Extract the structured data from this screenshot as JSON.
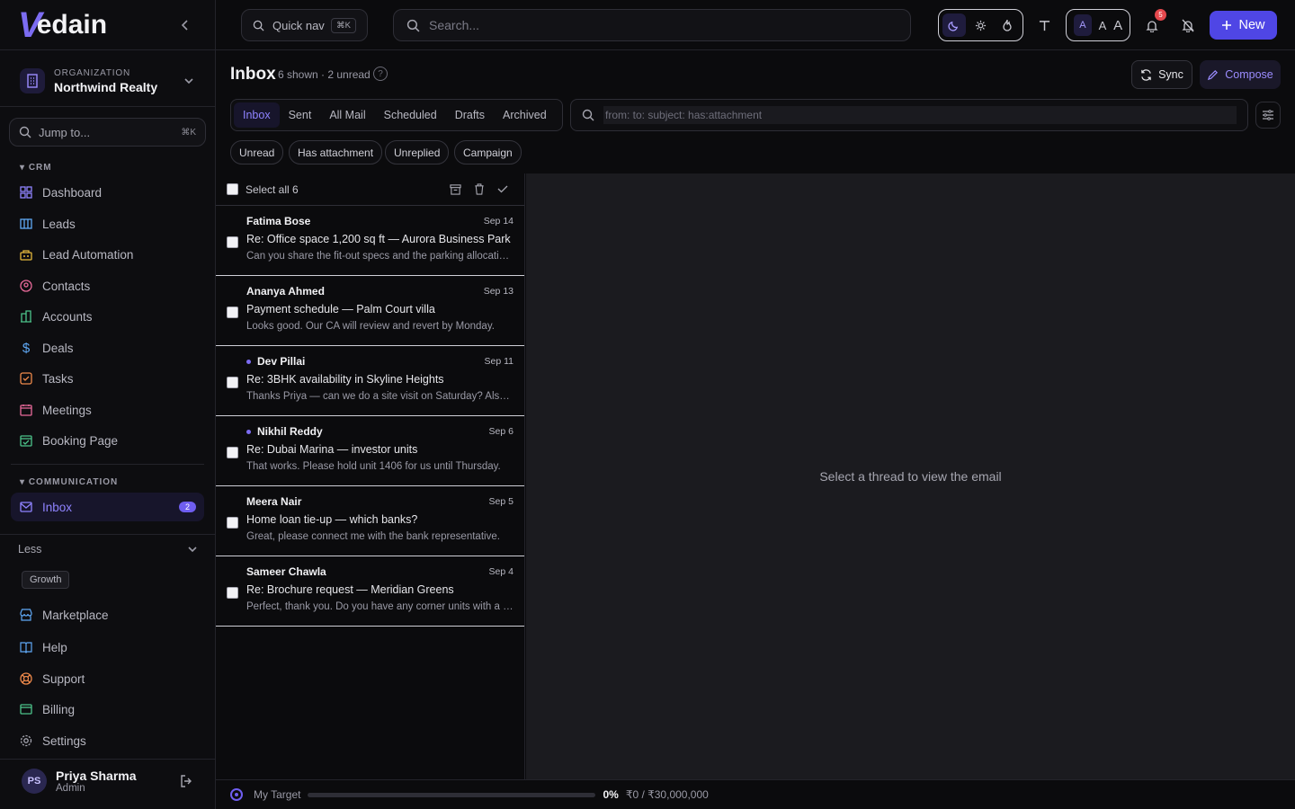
{
  "brand": {
    "mark": "V",
    "word": "edain"
  },
  "org": {
    "label": "ORGANIZATION",
    "name": "Northwind Realty"
  },
  "jump": {
    "label": "Jump to...",
    "shortcut": "⌘K"
  },
  "sections": {
    "crm": "CRM",
    "communication": "COMMUNICATION"
  },
  "crm_items": [
    {
      "label": "Dashboard",
      "icon": "dashboard-icon"
    },
    {
      "label": "Leads",
      "icon": "leads-icon"
    },
    {
      "label": "Lead Automation",
      "icon": "automation-icon"
    },
    {
      "label": "Contacts",
      "icon": "contacts-icon"
    },
    {
      "label": "Accounts",
      "icon": "accounts-icon"
    },
    {
      "label": "Deals",
      "icon": "dollar-icon"
    },
    {
      "label": "Tasks",
      "icon": "tasks-icon"
    },
    {
      "label": "Meetings",
      "icon": "calendar-icon"
    },
    {
      "label": "Booking Page",
      "icon": "booking-icon"
    }
  ],
  "comm_items": [
    {
      "label": "Inbox",
      "badge": "2",
      "icon": "mail-icon"
    }
  ],
  "less": "Less",
  "growth": "Growth",
  "bottom_nav": [
    {
      "label": "Marketplace",
      "icon": "store-icon"
    },
    {
      "label": "Help",
      "icon": "book-icon"
    },
    {
      "label": "Support",
      "icon": "lifebuoy-icon"
    },
    {
      "label": "Billing",
      "icon": "card-icon"
    },
    {
      "label": "Settings",
      "icon": "gear-icon"
    }
  ],
  "user": {
    "initials": "PS",
    "name": "Priya Sharma",
    "role": "Admin"
  },
  "topbar": {
    "quick_nav": "Quick nav",
    "quick_nav_kbd": "⌘K",
    "search_placeholder": "Search...",
    "font_sizes": [
      "A",
      "A",
      "A"
    ],
    "notif_count": "5",
    "new_label": "New"
  },
  "header": {
    "title": "Inbox",
    "subtitle": "6 shown · 2 unread",
    "help": "?",
    "sync": "Sync",
    "compose": "Compose"
  },
  "tabs": [
    "Inbox",
    "Sent",
    "All Mail",
    "Scheduled",
    "Drafts",
    "Archived"
  ],
  "query_placeholder": "from: to: subject: has:attachment",
  "chips": [
    "Unread",
    "Has attachment",
    "Unreplied",
    "Campaign"
  ],
  "select_all": "Select all 6",
  "threads": [
    {
      "from": "Fatima Bose",
      "date": "Sep 14",
      "subject": "Re: Office space 1,200 sq ft — Aurora Business Park",
      "preview": "Can you share the fit-out specs and the parking allocation?",
      "unread": false
    },
    {
      "from": "Ananya Ahmed",
      "date": "Sep 13",
      "subject": "Payment schedule — Palm Court villa",
      "preview": "Looks good. Our CA will review and revert by Monday.",
      "unread": false
    },
    {
      "from": "Dev Pillai",
      "date": "Sep 11",
      "subject": "Re: 3BHK availability in Skyline Heights",
      "preview": "Thanks Priya — can we do a site visit on Saturday? Also wh...",
      "unread": true
    },
    {
      "from": "Nikhil Reddy",
      "date": "Sep 6",
      "subject": "Re: Dubai Marina — investor units",
      "preview": "That works. Please hold unit 1406 for us until Thursday.",
      "unread": true
    },
    {
      "from": "Meera Nair",
      "date": "Sep 5",
      "subject": "Home loan tie-up — which banks?",
      "preview": "Great, please connect me with the bank representative.",
      "unread": false
    },
    {
      "from": "Sameer Chawla",
      "date": "Sep 4",
      "subject": "Re: Brochure request — Meridian Greens",
      "preview": "Perfect, thank you. Do you have any corner units with a pa...",
      "unread": false
    }
  ],
  "empty_detail": "Select a thread to view the email",
  "target": {
    "label": "My Target",
    "percent": "0%",
    "progress": 0,
    "amount": "₹0 / ₹30,000,000"
  },
  "colors": {
    "accent": "#6f5ef0",
    "primary_button": "#4f46e5",
    "badge_red": "#e5484d"
  }
}
